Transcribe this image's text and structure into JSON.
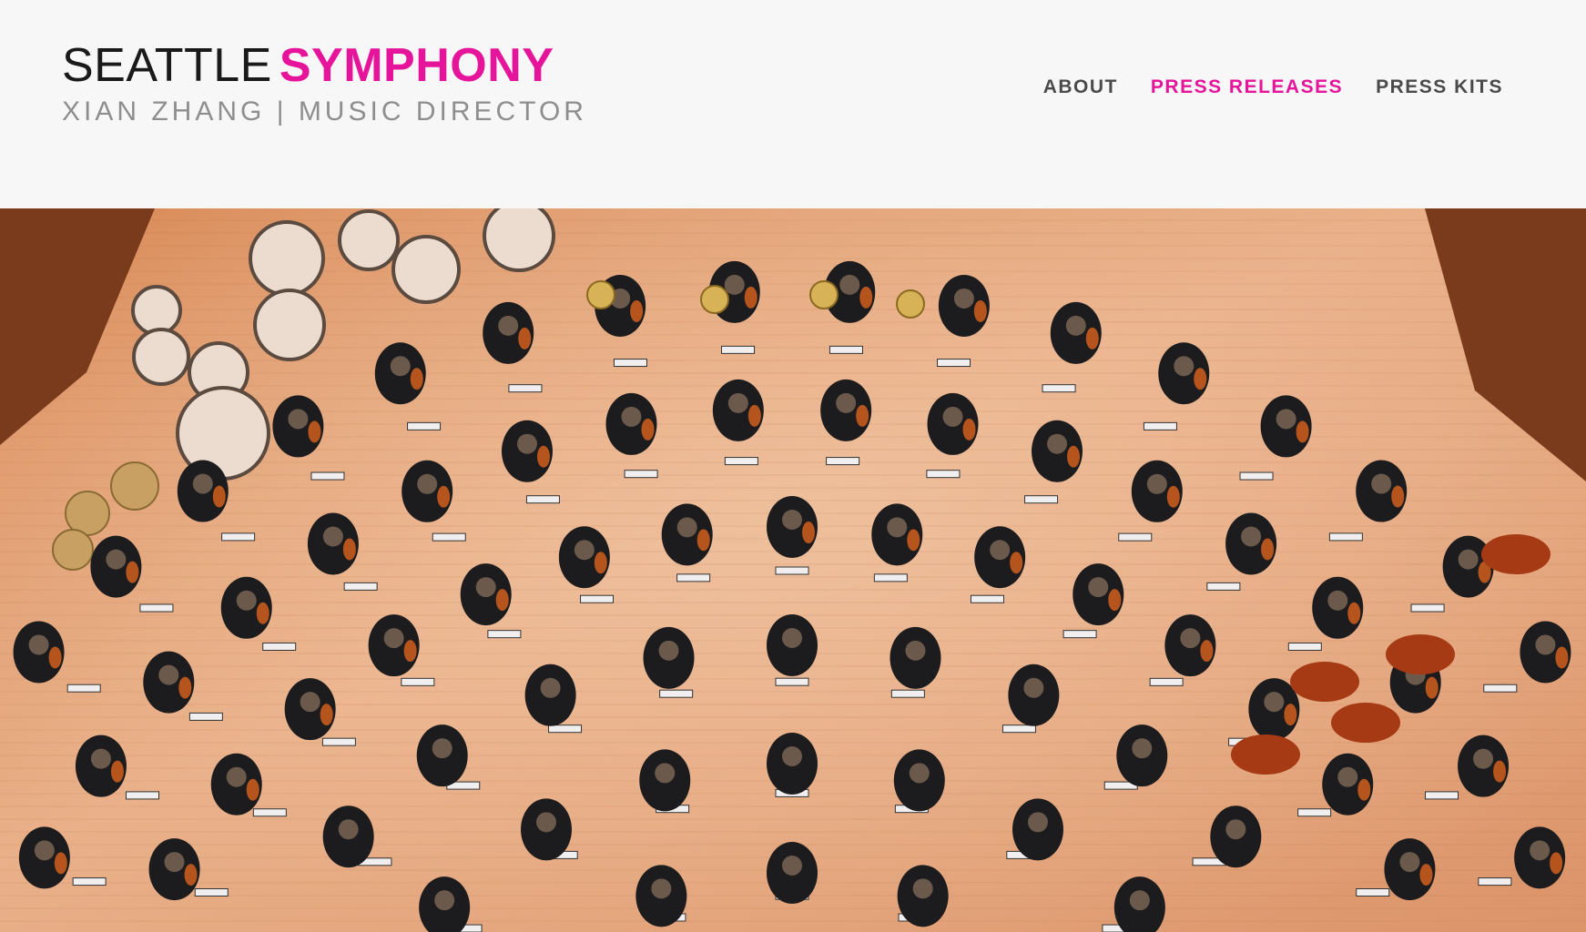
{
  "header": {
    "logo": {
      "primary": "SEATTLE",
      "accent": "SYMPHONY",
      "subtitle": "XIAN ZHANG | MUSIC DIRECTOR"
    },
    "nav": [
      {
        "label": "ABOUT",
        "active": false
      },
      {
        "label": "PRESS RELEASES",
        "active": true
      },
      {
        "label": "PRESS KITS",
        "active": false
      }
    ]
  },
  "hero": {
    "image_subject": "overhead-orchestra-photo"
  },
  "colors": {
    "accent": "#e5149a",
    "background": "#f7f7f7",
    "nav_text": "#4a4a4a",
    "subtitle": "#8e8e8e"
  }
}
